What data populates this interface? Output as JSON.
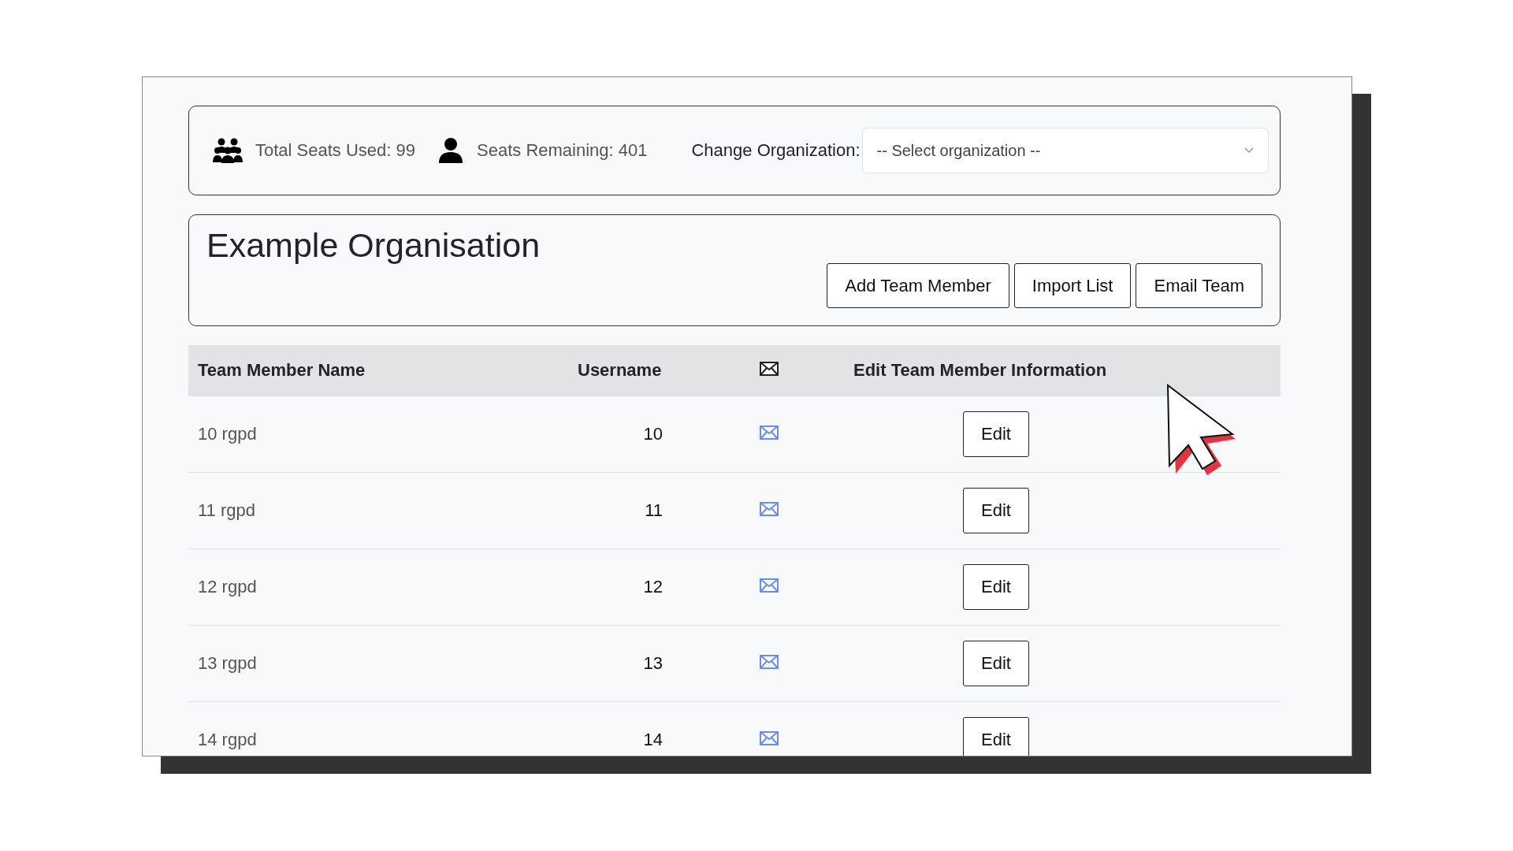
{
  "seats": {
    "used": "Total Seats Used: 99",
    "remaining": "Seats Remaining: 401"
  },
  "organization_picker": {
    "label": "Change Organization:",
    "placeholder": "-- Select organization --"
  },
  "organization": {
    "title": "Example Organisation",
    "buttons": [
      "Add Team Member",
      "Import List",
      "Email Team"
    ]
  },
  "table": {
    "columns": [
      {
        "kind": "text",
        "label": "Team Member Name"
      },
      {
        "kind": "text",
        "label": "Username"
      },
      {
        "kind": "mail"
      },
      {
        "kind": "text",
        "label": "Edit Team Member Information"
      }
    ],
    "rows": [
      {
        "name": "10 rgpd",
        "username": "10",
        "action": "Edit"
      },
      {
        "name": "11 rgpd",
        "username": "11",
        "action": "Edit"
      },
      {
        "name": "12 rgpd",
        "username": "12",
        "action": "Edit"
      },
      {
        "name": "13 rgpd",
        "username": "13",
        "action": "Edit"
      },
      {
        "name": "14 rgpd",
        "username": "14",
        "action": "Edit"
      }
    ]
  }
}
